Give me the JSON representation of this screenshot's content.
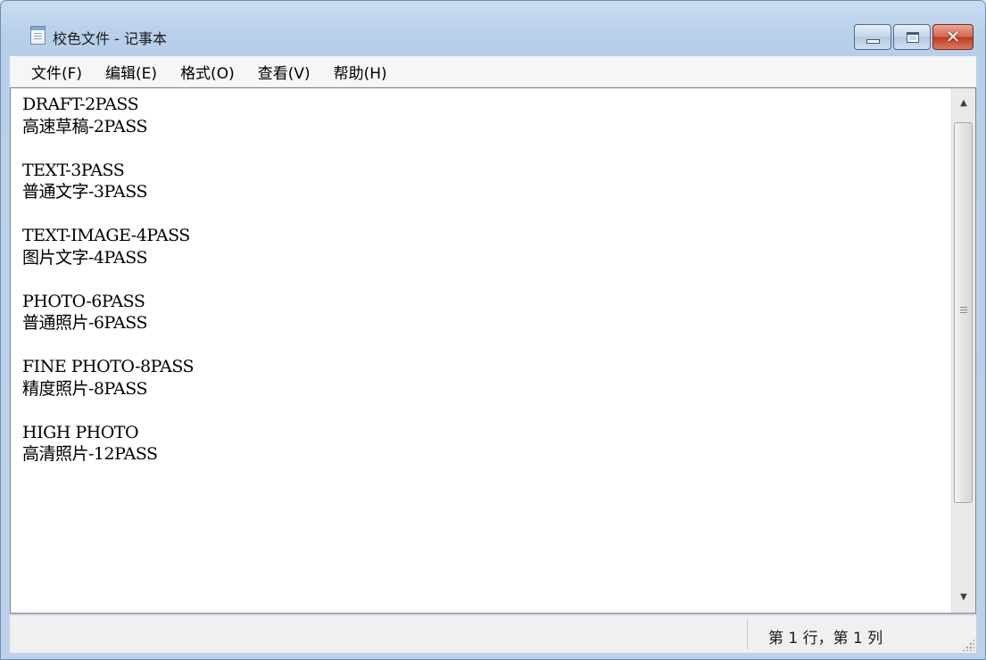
{
  "window": {
    "title": "校色文件 - 记事本"
  },
  "menu": {
    "items": [
      {
        "label": "文件(F)"
      },
      {
        "label": "编辑(E)"
      },
      {
        "label": "格式(O)"
      },
      {
        "label": "查看(V)"
      },
      {
        "label": "帮助(H)"
      }
    ]
  },
  "editor": {
    "content": "DRAFT-2PASS\n高速草稿-2PASS\n\nTEXT-3PASS\n普通文字-3PASS\n\nTEXT-IMAGE-4PASS\n图片文字-4PASS\n\nPHOTO-6PASS\n普通照片-6PASS\n\nFINE PHOTO-8PASS\n精度照片-8PASS\n\nHIGH PHOTO\n高清照片-12PASS"
  },
  "scrollbar": {
    "up_arrow": "▲",
    "down_arrow": "▼"
  },
  "caption": {
    "close_glyph": "✕"
  },
  "statusbar": {
    "position": "第 1 行，第 1 列"
  }
}
